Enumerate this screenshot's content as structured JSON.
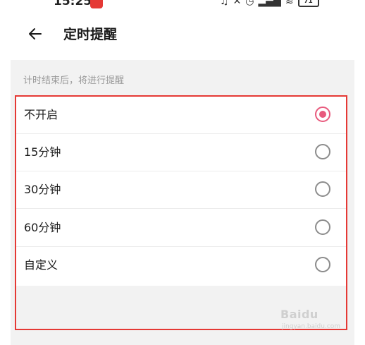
{
  "status_bar": {
    "time": "15:25",
    "battery": "71"
  },
  "header": {
    "title": "定时提醒"
  },
  "section": {
    "hint": "计时结束后，将进行提醒"
  },
  "options": [
    {
      "label": "不开启",
      "selected": true
    },
    {
      "label": "15分钟",
      "selected": false
    },
    {
      "label": "30分钟",
      "selected": false
    },
    {
      "label": "60分钟",
      "selected": false
    },
    {
      "label": "自定义",
      "selected": false
    }
  ],
  "colors": {
    "accent": "#e85a7d",
    "highlight": "#e53935",
    "section_bg": "#f2f2f2"
  },
  "icons": {
    "back": "arrow-left-icon"
  }
}
